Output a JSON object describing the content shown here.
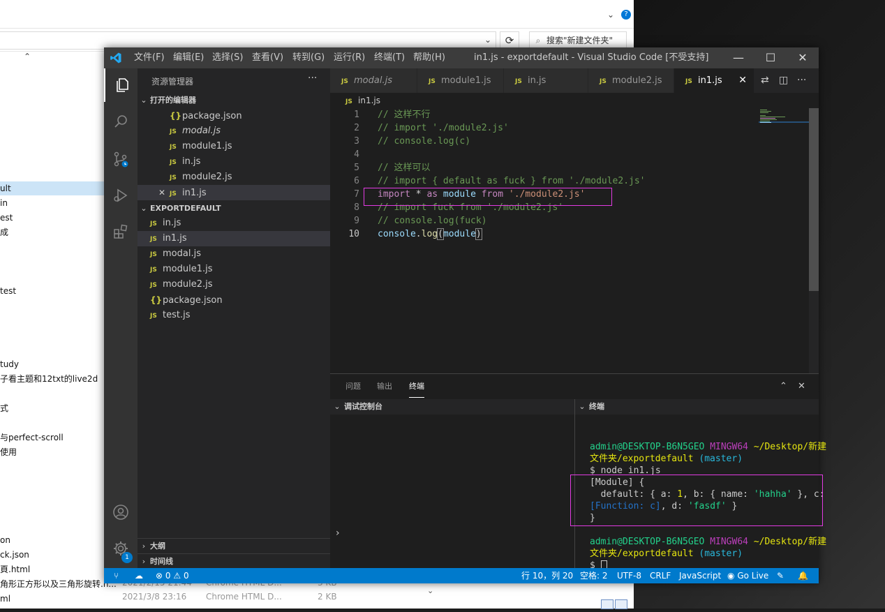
{
  "explorer": {
    "search_placeholder": "搜索\"新建文件夹\"",
    "refresh_icon": "⟳",
    "sidebar_items": [
      {
        "label": "",
        "top": 0
      },
      {
        "label": "ult"
      },
      {
        "label": "in"
      },
      {
        "label": "est"
      },
      {
        "label": "成"
      },
      {
        "label": "test"
      },
      {
        "label": "tudy"
      },
      {
        "label": "子看主题和12txt的live2d"
      },
      {
        "label": "式"
      },
      {
        "label": "与perfect-scroll"
      },
      {
        "label": "使用"
      },
      {
        "label": "on"
      },
      {
        "label": "ck.json"
      },
      {
        "label": "頁.html"
      },
      {
        "label": "角形正方形以及三角形旋转.h..."
      },
      {
        "label": "ml"
      }
    ],
    "bottom_rows": [
      {
        "date": "2021/2/15 21:44",
        "type": "Chrome HTML D...",
        "size": "3 KB"
      },
      {
        "date": "2021/3/8 23:16",
        "type": "Chrome HTML D...",
        "size": "2 KB"
      }
    ]
  },
  "vscode": {
    "menu": [
      "文件(F)",
      "编辑(E)",
      "选择(S)",
      "查看(V)",
      "转到(G)",
      "运行(R)",
      "终端(T)",
      "帮助(H)"
    ],
    "window_title": "in1.js - exportdefault - Visual Studio Code [不受支持]",
    "window_controls": {
      "minimize": "—",
      "maximize": "☐",
      "close": "✕"
    },
    "sidebar": {
      "title": "资源管理器",
      "more": "···",
      "open_editors_label": "打开的编辑器",
      "open_editors": [
        {
          "icon": "{}",
          "name": "package.json",
          "italic": false
        },
        {
          "icon": "JS",
          "name": "modal.js",
          "italic": true
        },
        {
          "icon": "JS",
          "name": "module1.js",
          "italic": false
        },
        {
          "icon": "JS",
          "name": "in.js",
          "italic": false
        },
        {
          "icon": "JS",
          "name": "module2.js",
          "italic": false
        },
        {
          "icon": "JS",
          "name": "in1.js",
          "italic": false
        }
      ],
      "folder_label": "EXPORTDEFAULT",
      "files": [
        {
          "icon": "JS",
          "name": "in.js"
        },
        {
          "icon": "JS",
          "name": "in1.js"
        },
        {
          "icon": "JS",
          "name": "modal.js"
        },
        {
          "icon": "JS",
          "name": "module1.js"
        },
        {
          "icon": "JS",
          "name": "module2.js"
        },
        {
          "icon": "{}",
          "name": "package.json"
        },
        {
          "icon": "JS",
          "name": "test.js"
        }
      ],
      "outline_label": "大纲",
      "timeline_label": "时间线"
    },
    "tabs": [
      {
        "icon": "JS",
        "name": "modal.js"
      },
      {
        "icon": "JS",
        "name": "module1.js"
      },
      {
        "icon": "JS",
        "name": "in.js"
      },
      {
        "icon": "JS",
        "name": "module2.js"
      },
      {
        "icon": "JS",
        "name": "in1.js"
      }
    ],
    "breadcrumb": "in1.js",
    "code_lines": [
      "1",
      "2",
      "3",
      "4",
      "5",
      "6",
      "7",
      "8",
      "9",
      "10"
    ],
    "code": {
      "l1": "// 这样不行",
      "l2": "// import './module2.js'",
      "l3": "// console.log(c)",
      "l5": "// 这样可以",
      "l6": "// import { default as fuck } from './module2.js'",
      "l7_import": "import",
      "l7_star": " * ",
      "l7_as": "as",
      "l7_module": " module ",
      "l7_from": "from",
      "l7_str": " './module2.js'",
      "l8": "// import fuck from './module2.js'",
      "l9": "// console.log(fuck)",
      "l10_console": "console",
      "l10_dot": ".",
      "l10_log": "log",
      "l10_open": "(",
      "l10_module": "module",
      "l10_close": ")"
    },
    "panel": {
      "tabs": [
        "问题",
        "输出",
        "终端"
      ],
      "debug_header": "调试控制台",
      "terminal_header": "终端",
      "debug_prompt": "›",
      "terminal": {
        "user": "admin@DESKTOP-B6N5GEO",
        "shell": "MINGW64",
        "path1": "~/Desktop/新建",
        "path2": "文件夹/exportdefault",
        "branch": "(master)",
        "cmd": "$ node in1.js",
        "out1": "[Module] {",
        "out2a": "  default: { a: ",
        "out2b": "1",
        "out2c": ", b: { name: ",
        "out2d": "'hahha'",
        "out2e": " }, c:",
        "out3a": "[Function: c]",
        "out3b": ", d: ",
        "out3c": "'fasdf'",
        "out3d": " }",
        "out4": "}",
        "prompt": "$"
      }
    },
    "statusbar": {
      "errors": "0",
      "warnings": "0",
      "position": "行 10，列 20",
      "spaces": "空格: 2",
      "encoding": "UTF-8",
      "eol": "CRLF",
      "language": "JavaScript",
      "golive": "Go Live"
    },
    "accounts_badge": "1"
  },
  "colors": {
    "accent": "#007acc",
    "highlight_box": "#e33be3"
  }
}
